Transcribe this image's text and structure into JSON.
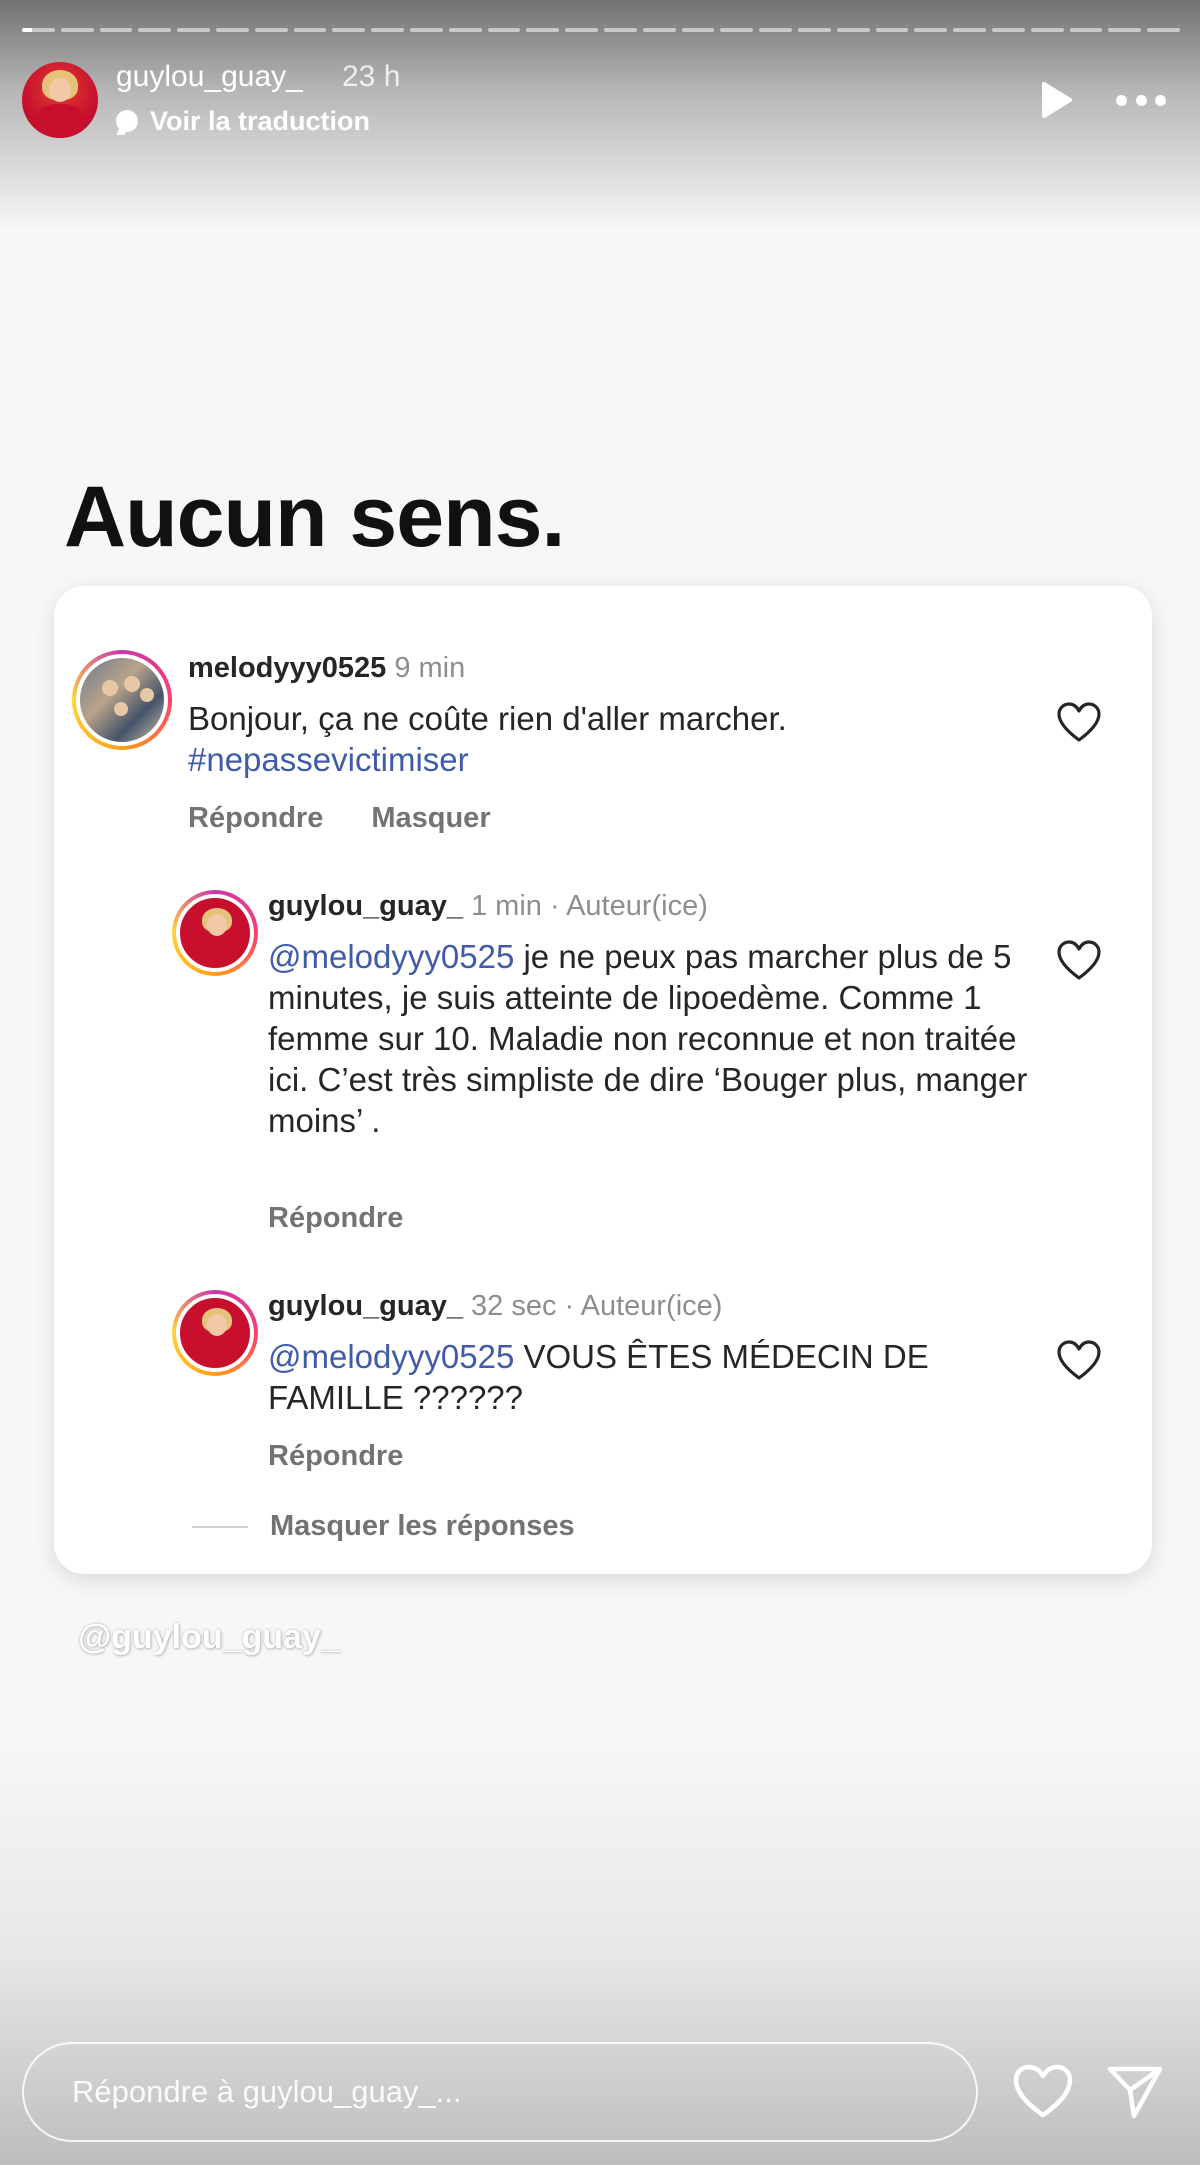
{
  "header": {
    "username": "guylou_guay_",
    "time_ago": "23 h",
    "translate_label": "Voir la traduction",
    "progress_segments": 30,
    "progress_current_index": 0,
    "progress_current_fill": 0.3,
    "play_icon": "play-icon",
    "more_icon": "more-options-icon"
  },
  "headline": "Aucun sens.",
  "comments": [
    {
      "username": "melodyyy0525",
      "time": "9 min",
      "text": "Bonjour, ça ne coûte rien d'aller marcher.",
      "hashtag": "#nepassevictimiser",
      "actions": [
        "Répondre",
        "Masquer"
      ]
    },
    {
      "username": "guylou_guay_",
      "time": "1 min · Auteur(ice)",
      "mention": "@melodyyy0525",
      "text": " je ne peux pas marcher plus de 5 minutes, je suis atteinte de lipoedème. Comme 1 femme sur 10. Maladie non reconnue et non traitée ici. C’est très simpliste de dire ‘Bouger plus, manger moins’ .",
      "actions": [
        "Répondre"
      ]
    },
    {
      "username": "guylou_guay_",
      "time": "32 sec · Auteur(ice)",
      "mention": "@melodyyy0525",
      "text": " VOUS ÊTES MÉDECIN DE FAMILLE ??????",
      "actions": [
        "Répondre"
      ]
    }
  ],
  "hide_replies_label": "Masquer les réponses",
  "watermark": "@guylou_guay_",
  "reply": {
    "placeholder": "Répondre à guylou_guay_..."
  },
  "colors": {
    "mention": "#3f5ba9",
    "muted": "#737373",
    "text": "#262626"
  }
}
